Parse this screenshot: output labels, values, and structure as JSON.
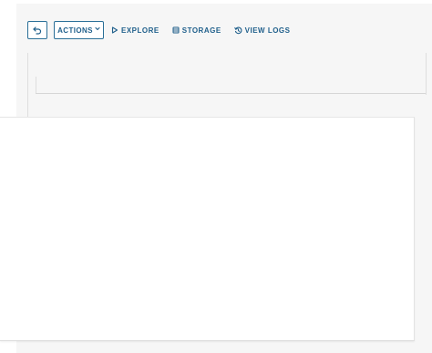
{
  "toolbar": {
    "back_icon": "undo-arrow-icon",
    "actions_label": "ACTIONS",
    "actions_caret": "chevron-down-icon",
    "explore_label": "EXPLORE",
    "explore_icon": "play-outline-icon",
    "storage_label": "STORAGE",
    "storage_icon": "database-icon",
    "view_logs_label": "VIEW LOGS",
    "view_logs_icon": "history-icon"
  },
  "colors": {
    "accent": "#1f5f8b",
    "workspace_bg": "#f6f6f6",
    "content_bg": "#ffffff"
  }
}
